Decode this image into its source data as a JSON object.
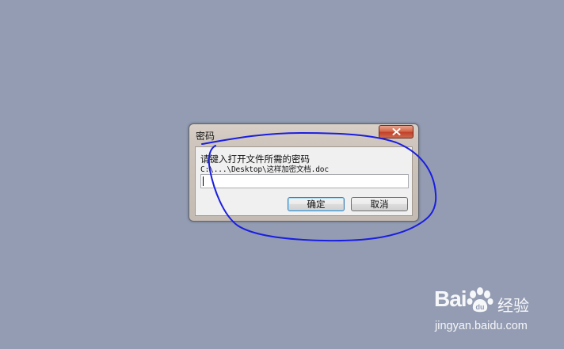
{
  "dialog": {
    "title": "密码",
    "close_icon": "close-icon",
    "prompt": "请键入打开文件所需的密码",
    "path": "C:\\...\\Desktop\\这样加密文档.doc",
    "password_value": "",
    "ok_label": "确定",
    "cancel_label": "取消"
  },
  "annotation": {
    "color": "#1a1ee0"
  },
  "watermark": {
    "logo_text": "Bai  ",
    "logo_suffix": "经验",
    "url": "jingyan.baidu.com"
  }
}
